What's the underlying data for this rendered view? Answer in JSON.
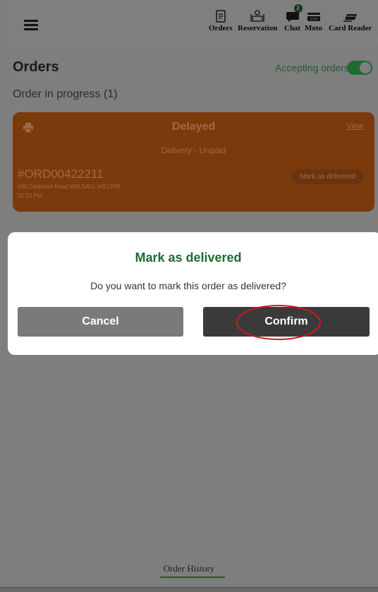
{
  "header": {
    "nav": [
      {
        "label": "Orders",
        "icon": "orders-icon"
      },
      {
        "label": "Reservation",
        "icon": "reservation-icon"
      },
      {
        "label": "Chat",
        "icon": "chat-icon",
        "badge": "2"
      },
      {
        "label": "Moto",
        "icon": "moto-icon"
      },
      {
        "label": "Card Reader",
        "icon": "card-reader-icon"
      }
    ]
  },
  "main": {
    "title": "Orders",
    "accepting_label": "Accepting orders",
    "accepting_on": true,
    "progress_label": "Order in progress (1)"
  },
  "order": {
    "status": "Delayed",
    "view_label": "View",
    "delivery": "Delivery - Unpaid",
    "id": "#ORD00422211",
    "address": "199,Caldmore Road,WALSALL,WS13RB",
    "time": "02:33 PM",
    "mark_label": "Mark as delivered"
  },
  "modal": {
    "title": "Mark as delivered",
    "message": "Do you want to mark this order as delivered?",
    "cancel_label": "Cancel",
    "confirm_label": "Confirm"
  },
  "footer": {
    "history_label": "Order History"
  },
  "colors": {
    "accent_green": "#1f6b2f",
    "order_card": "#7a3a0b",
    "highlight_circle": "#d11a1a"
  }
}
